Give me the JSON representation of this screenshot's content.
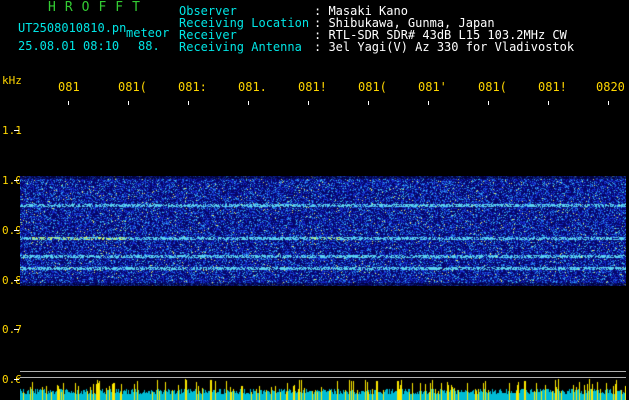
{
  "header": {
    "brand": "HROFFT",
    "filename": "UT2508010810.pn",
    "meteor_label": "meteor",
    "datetime": "25.08.01 08:10",
    "count": "88.",
    "info_labels": [
      "Observer",
      "Receiving Location",
      "Receiver",
      "Receiving Antenna"
    ],
    "info_values": [
      ": Masaki Kano",
      ": Shibukawa, Gunma, Japan",
      ": RTL-SDR SDR# 43dB L15 103.2MHz CW",
      ": 3el Yagi(V) Az 330 for Vladivostok"
    ]
  },
  "time_axis": {
    "labels": [
      "081",
      "081(",
      "081:",
      "081.",
      "081!",
      "081(",
      "081'",
      "081(",
      "081!",
      "0820"
    ]
  },
  "freq_axis": {
    "unit": "kHz",
    "labels": [
      "1.1",
      "1.0",
      "0.9",
      "0.8",
      "0.7",
      "0.6"
    ]
  },
  "colors": {
    "brand": "#33cc33",
    "labels": "#00e5e5",
    "values": "#ffffff",
    "axis": "#ffd600",
    "spectro_bg": "#0a0a80",
    "signal_line": "#00e5e5",
    "bar_cyan": "#00bcd4",
    "bar_yellow": "#ffea00"
  }
}
